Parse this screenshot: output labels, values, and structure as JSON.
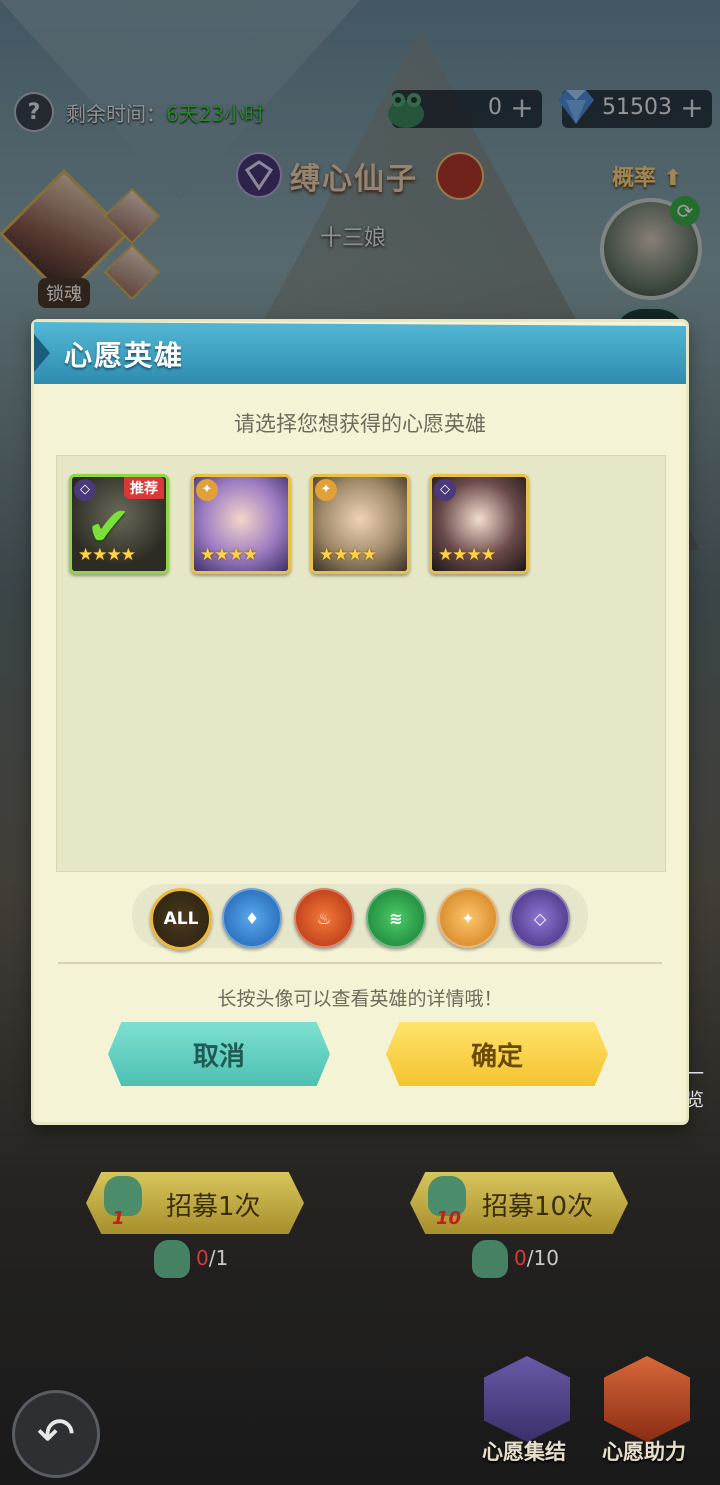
{
  "top": {
    "help_icon": "?",
    "timer_label": "剩余时间：",
    "timer_value": "6天23小时",
    "currency1": {
      "icon": "jade-toad-icon",
      "value": "0"
    },
    "currency2": {
      "icon": "diamond-icon",
      "value": "51503"
    }
  },
  "banner": {
    "title": "缚心仙子",
    "subtitle": "十三娘",
    "prob_label": "概率",
    "lock_label": "锁魂"
  },
  "dialog": {
    "title": "心愿英雄",
    "prompt": "请选择您想获得的心愿英雄",
    "heroes": [
      {
        "stars": "★★★★",
        "tag": "推荐",
        "selected": true,
        "element": "void"
      },
      {
        "stars": "★★★★",
        "element": "light"
      },
      {
        "stars": "★★★★",
        "element": "light"
      },
      {
        "stars": "★★★★",
        "element": "void"
      }
    ],
    "filters": [
      {
        "label": "ALL",
        "color": "#f0b83a"
      },
      {
        "label": "water",
        "color": "#2f7fd0"
      },
      {
        "label": "fire",
        "color": "#e0541f"
      },
      {
        "label": "wind",
        "color": "#2aa24a"
      },
      {
        "label": "light",
        "color": "#f2a53a"
      },
      {
        "label": "void",
        "color": "#6a4fb0"
      }
    ],
    "hint": "长按头像可以查看英雄的详情哦！",
    "cancel_label": "取消",
    "confirm_label": "确定"
  },
  "recruit": {
    "once_label": "招募1次",
    "once_count": "1",
    "once_cost_have": "0",
    "once_cost_need": "/1",
    "ten_label": "招募10次",
    "ten_count": "10",
    "ten_cost_have": "0",
    "ten_cost_need": "/10"
  },
  "side_label": "一览",
  "bottom": {
    "wish_gather": "心愿集结",
    "wish_help": "心愿助力"
  }
}
